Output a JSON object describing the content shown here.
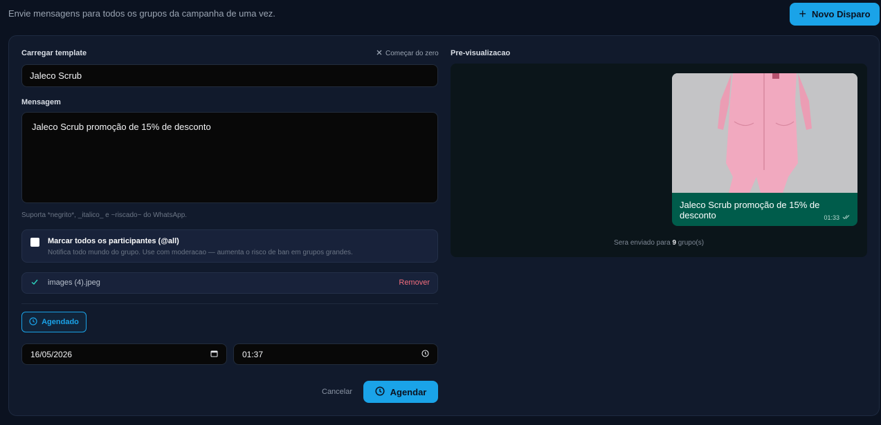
{
  "header": {
    "description": "Envie mensagens para todos os grupos da campanha de uma vez.",
    "new_button_label": "Novo Disparo"
  },
  "form": {
    "template_label": "Carregar template",
    "reset_label": "Começar do zero",
    "template_value": "Jaleco Scrub",
    "message_label": "Mensagem",
    "message_value": "Jaleco Scrub promoção de 15% de desconto",
    "format_hint": "Suporta *negrito*, _italico_ e ~riscado~ do WhatsApp.",
    "mention": {
      "title": "Marcar todos os participantes (@all)",
      "subtitle": "Notifica todo mundo do grupo. Use com moderacao — aumenta o risco de ban em grupos grandes.",
      "checked": false
    },
    "attachment": {
      "file_name": "images (4).jpeg",
      "remove_label": "Remover"
    },
    "schedule_toggle_label": "Agendado",
    "date_value": "16/05/2026",
    "time_value": "01:37",
    "cancel_label": "Cancelar",
    "submit_label": "Agendar"
  },
  "preview": {
    "label": "Pre-visualizacao",
    "bubble_text": "Jaleco Scrub promoção de 15% de desconto",
    "bubble_time": "01:33",
    "note_prefix": "Sera enviado para ",
    "group_count": "9",
    "note_suffix": " grupo(s)"
  },
  "colors": {
    "accent": "#1aa3e8",
    "bubble": "#005c4b",
    "danger": "#f26d7d"
  }
}
